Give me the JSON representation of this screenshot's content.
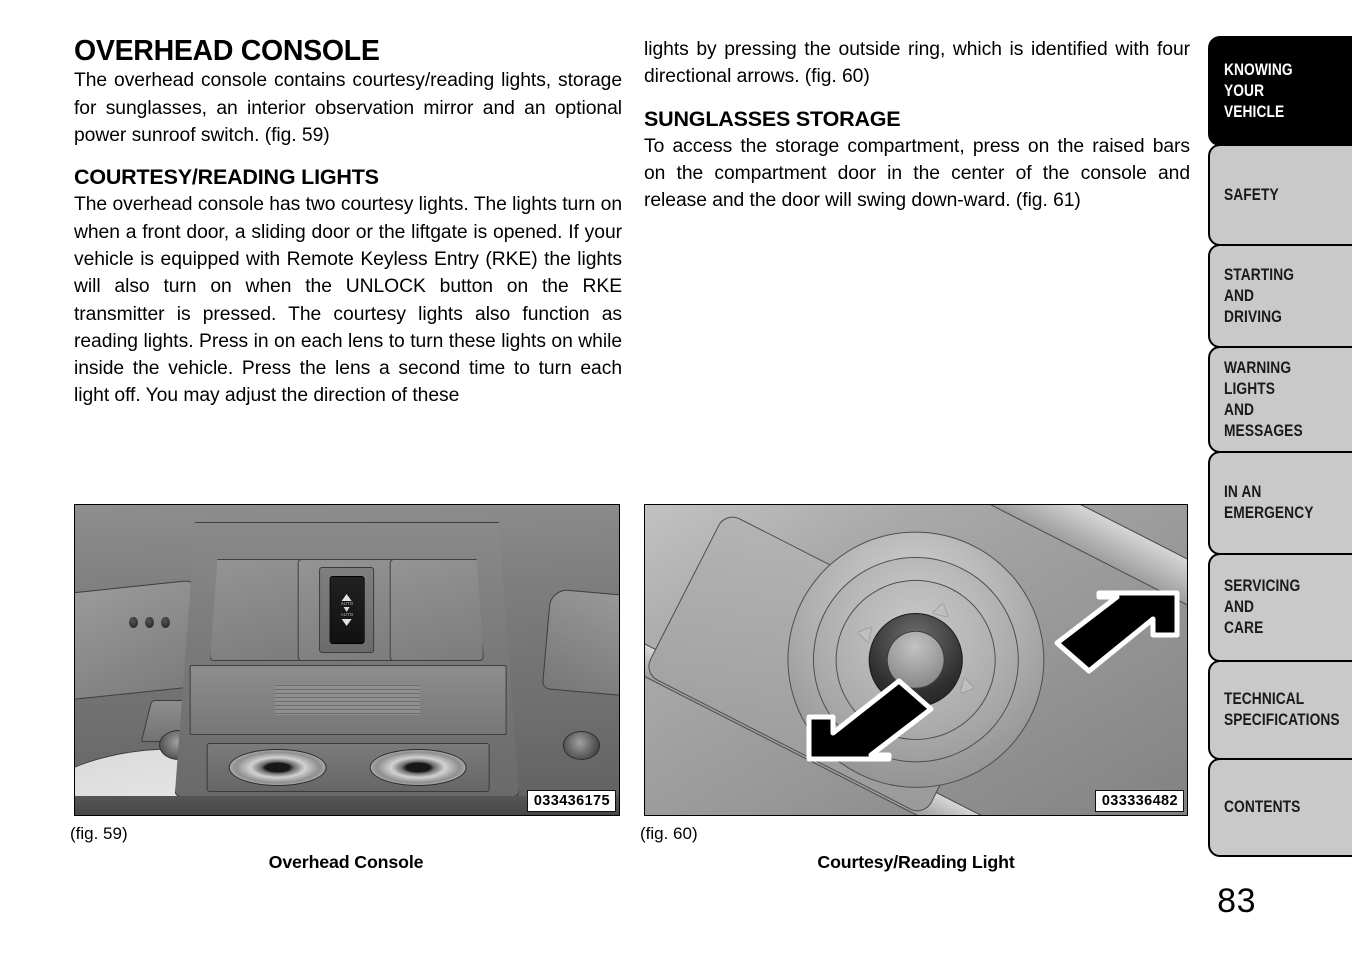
{
  "document": {
    "page_number": "83"
  },
  "left_column": {
    "section_title": "OVERHEAD CONSOLE",
    "intro_paragraph": "The overhead console contains courtesy/reading lights, storage for sunglasses, an interior observation mirror and an optional power sunroof switch. (fig. 59)",
    "subsection_title": "COURTESY/READING LIGHTS",
    "subsection_paragraph": "The overhead console has two courtesy lights. The lights turn on when a front door, a sliding door or the liftgate is opened. If your vehicle is equipped with Remote Keyless Entry (RKE) the lights will also turn on when the UNLOCK button on the RKE transmitter is pressed. The courtesy lights also function as reading lights. Press in on each lens to turn these lights on while inside the vehicle. Press the lens a second time to turn each light off. You may adjust the direction of these"
  },
  "right_column": {
    "continued_paragraph": "lights by pressing the outside ring, which is identified with four directional arrows. (fig. 60)",
    "subsection_title": "SUNGLASSES STORAGE",
    "subsection_paragraph": "To access the storage compartment, press on the raised bars on the compartment door in the center of the console and release and the door will swing down-ward. (fig. 61)"
  },
  "figures": [
    {
      "id": "fig-59",
      "reference": "(fig. 59)",
      "caption": "Overhead Console",
      "image_id": "033436175",
      "switch_label": "AUTO"
    },
    {
      "id": "fig-60",
      "reference": "(fig. 60)",
      "caption": "Courtesy/Reading Light",
      "image_id": "033336482"
    }
  ],
  "tab_strip": {
    "tabs": [
      {
        "label": "KNOWING\nYOUR\nVEHICLE",
        "active": true
      },
      {
        "label": "SAFETY",
        "active": false
      },
      {
        "label": "STARTING\nAND\nDRIVING",
        "active": false
      },
      {
        "label": "WARNING\nLIGHTS\nAND\nMESSAGES",
        "active": false
      },
      {
        "label": "IN AN\nEMERGENCY",
        "active": false
      },
      {
        "label": "SERVICING\nAND\nCARE",
        "active": false
      },
      {
        "label": "TECHNICAL\nSPECIFICATIONS",
        "active": false
      },
      {
        "label": "CONTENTS",
        "active": false
      }
    ]
  },
  "colors": {
    "active_tab_background": "#000000",
    "active_tab_text": "#ffffff",
    "tab_background": "#c9c9c9",
    "tab_border": "#000000",
    "page_background": "#ffffff",
    "text": "#000000"
  }
}
